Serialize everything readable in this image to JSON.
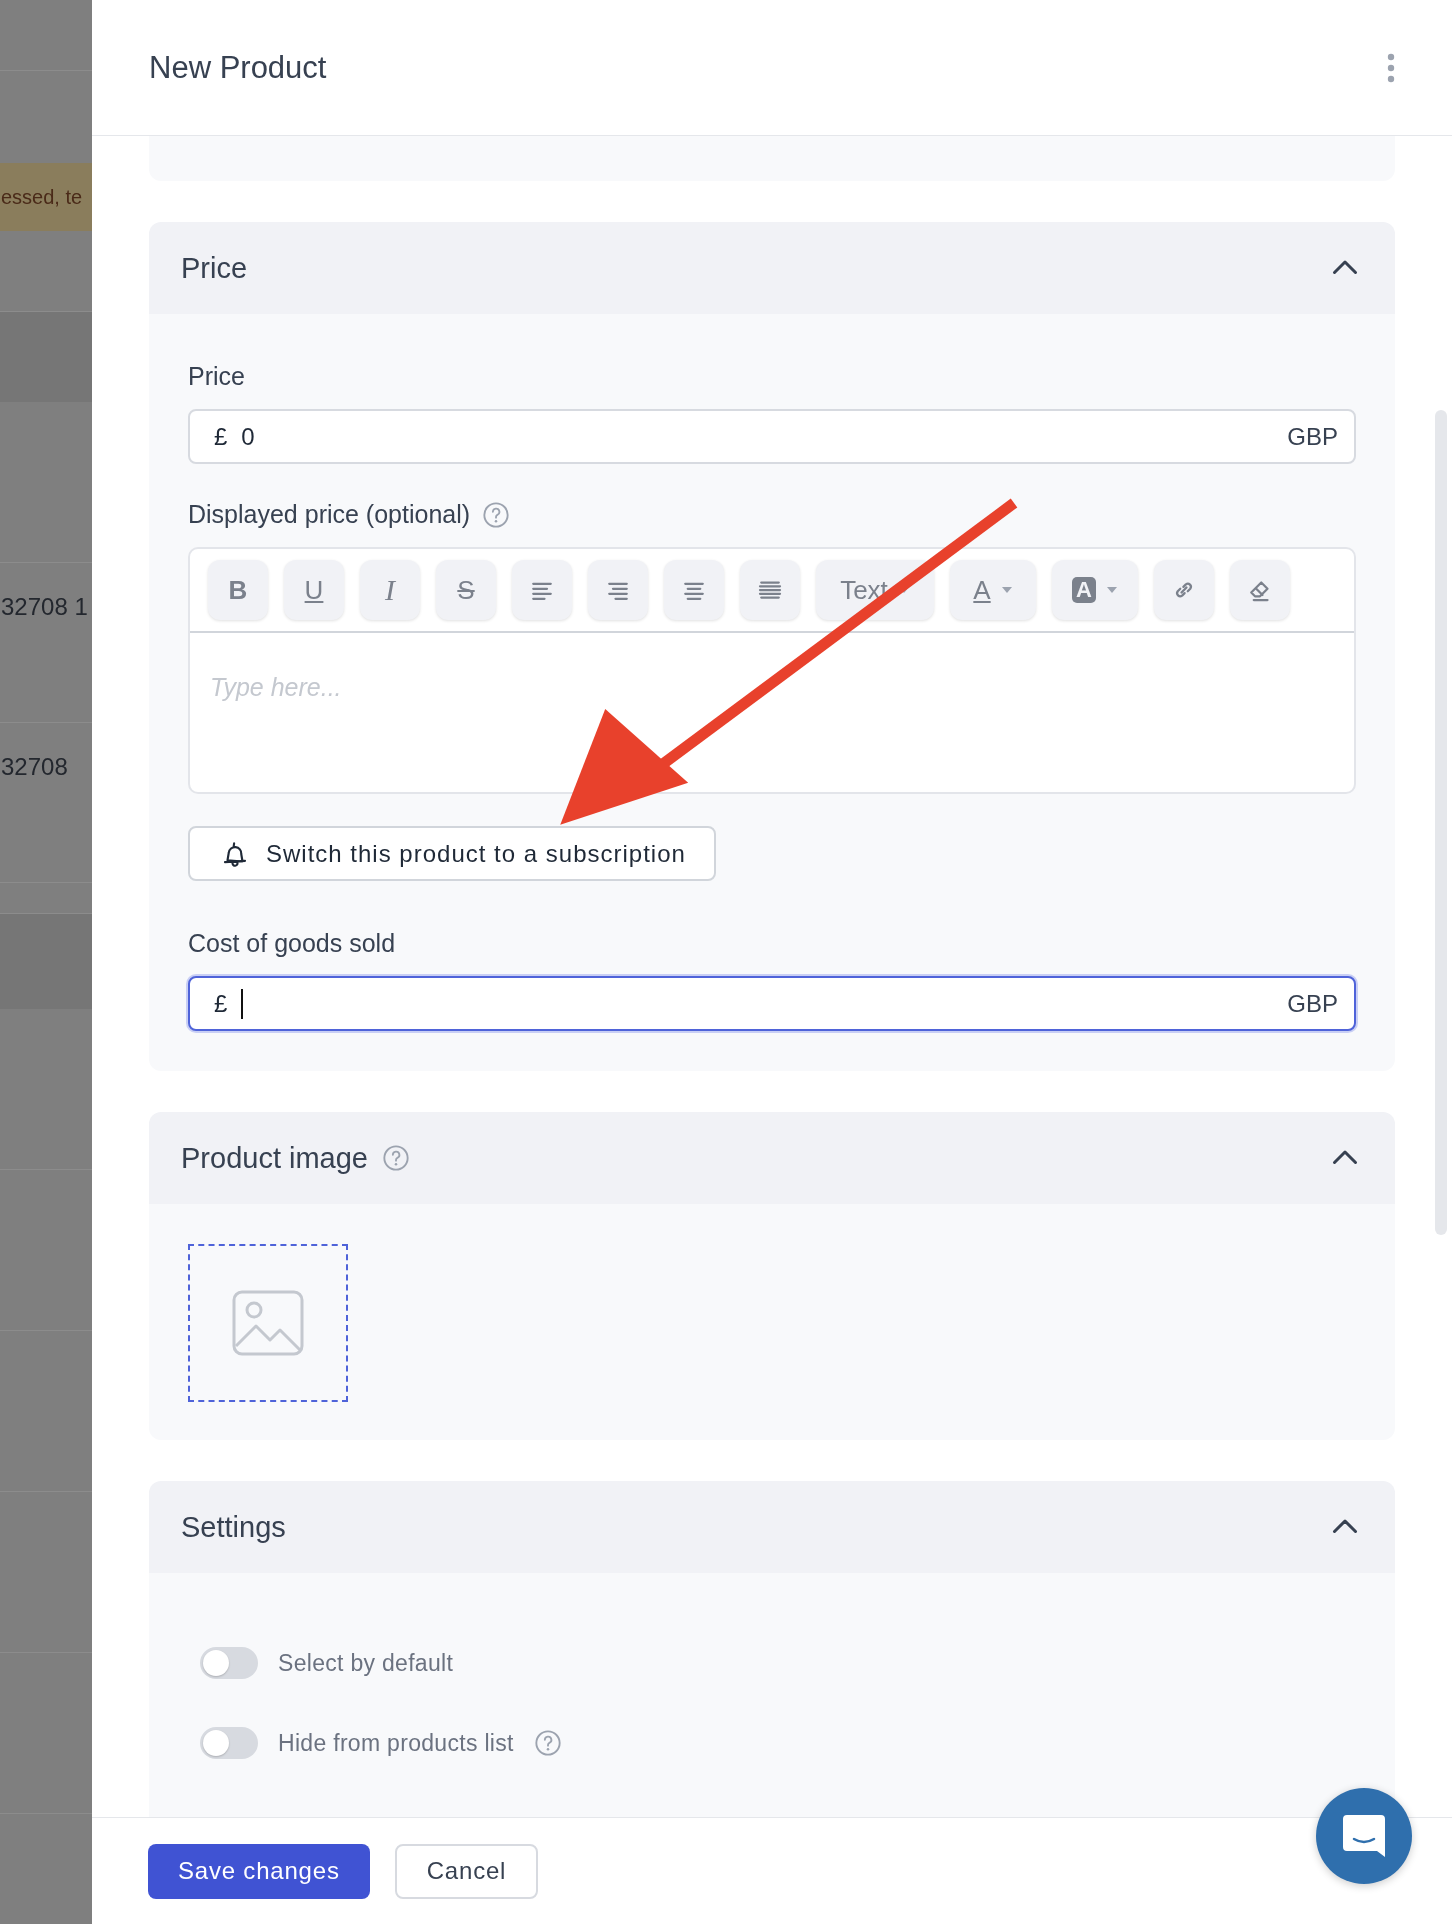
{
  "backdrop": {
    "rows": [
      {
        "kind": "notice",
        "text": "essed, te"
      },
      {
        "kind": "plain",
        "text": "32708 1"
      },
      {
        "kind": "plain",
        "text": "32708"
      }
    ]
  },
  "header": {
    "title": "New Product"
  },
  "price_section": {
    "title": "Price",
    "expanded": true,
    "price": {
      "label": "Price",
      "symbol": "£",
      "value": "0",
      "currency": "GBP",
      "focused": false
    },
    "displayed_price": {
      "label": "Displayed price (optional)",
      "help": true,
      "placeholder": "Type here...",
      "toolbar": [
        {
          "kind": "bold",
          "label": "B"
        },
        {
          "kind": "underline",
          "label": "U"
        },
        {
          "kind": "italic",
          "label": "I"
        },
        {
          "kind": "strike",
          "label": "S"
        },
        {
          "kind": "align-left"
        },
        {
          "kind": "align-right"
        },
        {
          "kind": "align-center"
        },
        {
          "kind": "justify"
        },
        {
          "kind": "format",
          "label": "Text"
        },
        {
          "kind": "text-color",
          "label": "A"
        },
        {
          "kind": "highlight-color",
          "label": "A"
        },
        {
          "kind": "link"
        },
        {
          "kind": "eraser"
        }
      ]
    },
    "subscription_button": "Switch this product to a subscription",
    "cost": {
      "label": "Cost of goods sold",
      "symbol": "£",
      "currency": "GBP",
      "focused": true
    }
  },
  "image_section": {
    "title": "Product image",
    "expanded": true,
    "help": true
  },
  "settings_section": {
    "title": "Settings",
    "expanded": true,
    "toggles": [
      {
        "label": "Select by default",
        "on": false
      },
      {
        "label": "Hide from products list",
        "on": false,
        "help": true
      }
    ]
  },
  "footer": {
    "buttons": [
      {
        "label": "Save changes",
        "kind": "primary"
      },
      {
        "label": "Cancel",
        "kind": "secondary"
      }
    ]
  }
}
